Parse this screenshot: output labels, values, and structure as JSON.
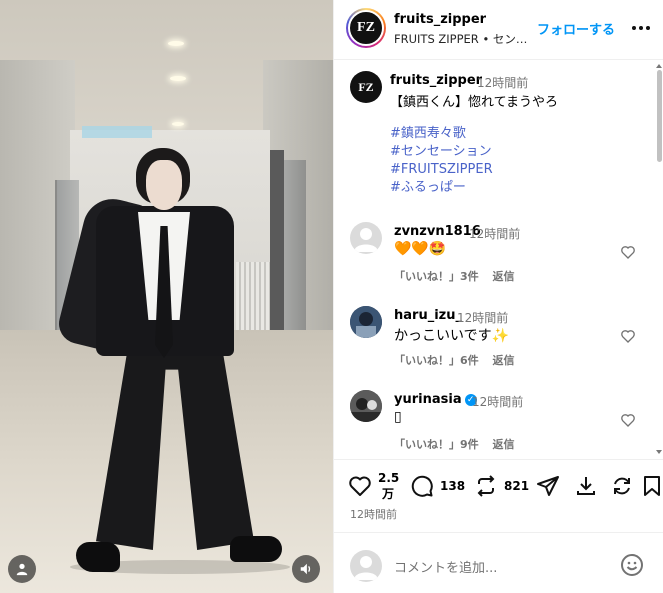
{
  "header": {
    "username": "fruits_zipper",
    "subtitle": "FRUITS ZIPPER • センセーション",
    "follow_label": "フォローする",
    "avatar_letters": "FZ"
  },
  "caption": {
    "username": "fruits_zipper",
    "time": "12時間前",
    "text": "【鎮西くん】惚れてまうやろ",
    "hashtags": [
      "#鎮西寿々歌",
      "#センセーション",
      "#FRUITSZIPPER",
      "#ふるっぱー"
    ]
  },
  "comments": [
    {
      "username": "zvnzvn1816",
      "time": "12時間前",
      "text": "🧡🧡🤩",
      "likes": "「いいね！」3件",
      "reply": "返信",
      "verified": false
    },
    {
      "username": "haru_izu_",
      "time": "12時間前",
      "text": "かっこいいです✨",
      "likes": "「いいね！」6件",
      "reply": "返信",
      "verified": false
    },
    {
      "username": "yurinasia",
      "time": "12時間前",
      "text": "▯",
      "likes": "「いいね！」9件",
      "reply": "返信",
      "verified": true
    }
  ],
  "actions": {
    "likes_line1": "2.5",
    "likes_line2": "万",
    "comments": "138",
    "reposts": "821"
  },
  "post_time": "12時間前",
  "add_comment_placeholder": "コメントを追加...",
  "colors": {
    "accent": "#0095f6",
    "hashtag": "#4a63c9",
    "muted": "#737373"
  },
  "icons": [
    "heart-icon",
    "comment-icon",
    "repost-icon",
    "share-icon",
    "download-icon",
    "refresh-icon",
    "bookmark-icon",
    "more-icon",
    "user-icon",
    "volume-icon",
    "emoji-icon"
  ]
}
